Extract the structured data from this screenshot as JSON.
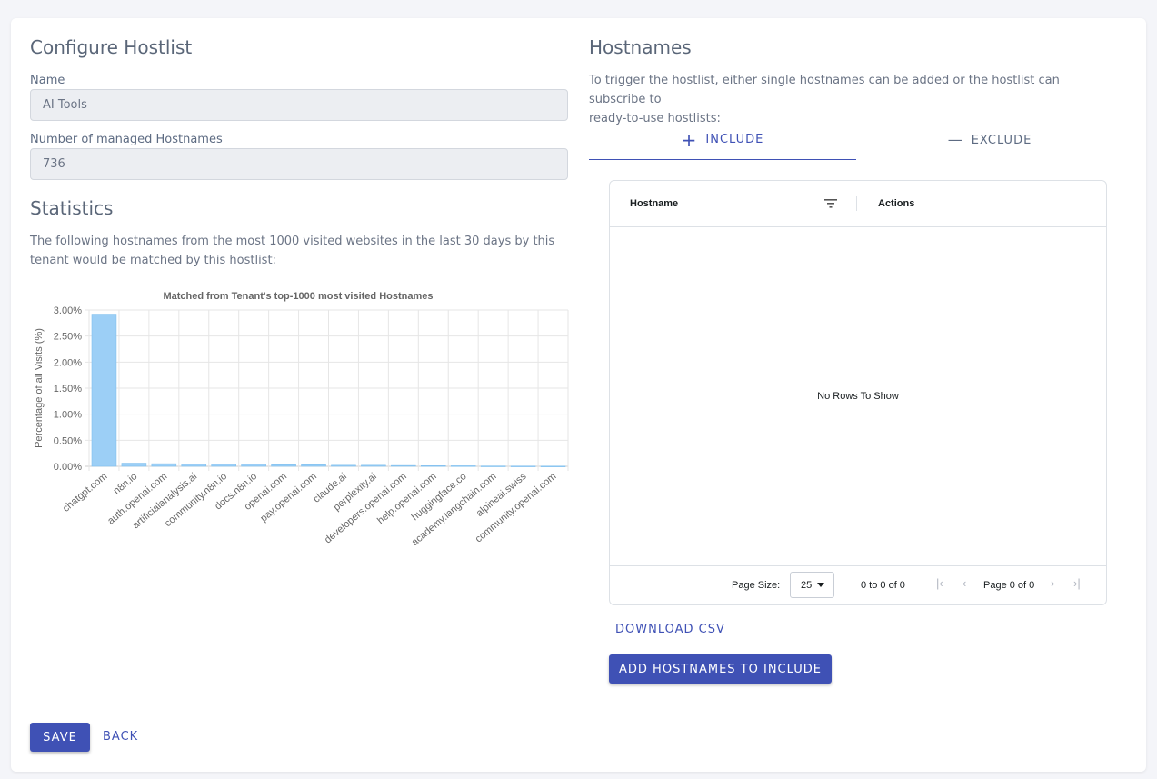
{
  "configure": {
    "title": "Configure Hostlist",
    "name_label": "Name",
    "name_value": "AI Tools",
    "managed_label": "Number of managed Hostnames",
    "managed_value": "736"
  },
  "statistics": {
    "title": "Statistics",
    "description": "The following hostnames from the most 1000 visited websites in the last 30 days by this tenant would be matched by this hostlist:"
  },
  "chart_data": {
    "type": "bar",
    "title": "Matched from Tenant's top-1000 most visited Hostnames",
    "xlabel": "",
    "ylabel": "Percentage of all Visits (%)",
    "ylim": [
      0,
      3.0
    ],
    "y_ticks": [
      "0.00%",
      "0.50%",
      "1.00%",
      "1.50%",
      "2.00%",
      "2.50%",
      "3.00%"
    ],
    "grid": true,
    "bar_color": "#9ccff6",
    "categories": [
      "chatgpt.com",
      "n8n.io",
      "auth.openai.com",
      "artificialanalysis.ai",
      "community.n8n.io",
      "docs.n8n.io",
      "openai.com",
      "pay.openai.com",
      "claude.ai",
      "perplexity.ai",
      "developers.openai.com",
      "help.openai.com",
      "huggingface.co",
      "academy.langchain.com",
      "alpineai.swiss",
      "community.openai.com"
    ],
    "values": [
      2.92,
      0.06,
      0.05,
      0.04,
      0.04,
      0.04,
      0.03,
      0.03,
      0.02,
      0.02,
      0.015,
      0.012,
      0.01,
      0.005,
      0.004,
      0.003
    ]
  },
  "hostnames": {
    "title": "Hostnames",
    "description_line1": "To trigger the hostlist, either single hostnames can be added or the hostlist can subscribe to",
    "description_line2": "ready-to-use hostlists:",
    "tab_include": "INCLUDE",
    "tab_exclude": "EXCLUDE",
    "tab_include_icon": "+",
    "tab_exclude_icon": "—"
  },
  "grid": {
    "col_hostname": "Hostname",
    "col_actions": "Actions",
    "no_rows": "No Rows To Show",
    "page_size_label": "Page Size:",
    "page_size_value": "25",
    "range_text": "0 to 0 of 0",
    "page_text": "Page 0 of 0",
    "first_icon": "|‹",
    "prev_icon": "‹",
    "next_icon": "›",
    "last_icon": "›|"
  },
  "actions": {
    "download_csv": "DOWNLOAD CSV",
    "add_hostnames": "ADD HOSTNAMES TO INCLUDE",
    "save": "SAVE",
    "back": "BACK"
  }
}
